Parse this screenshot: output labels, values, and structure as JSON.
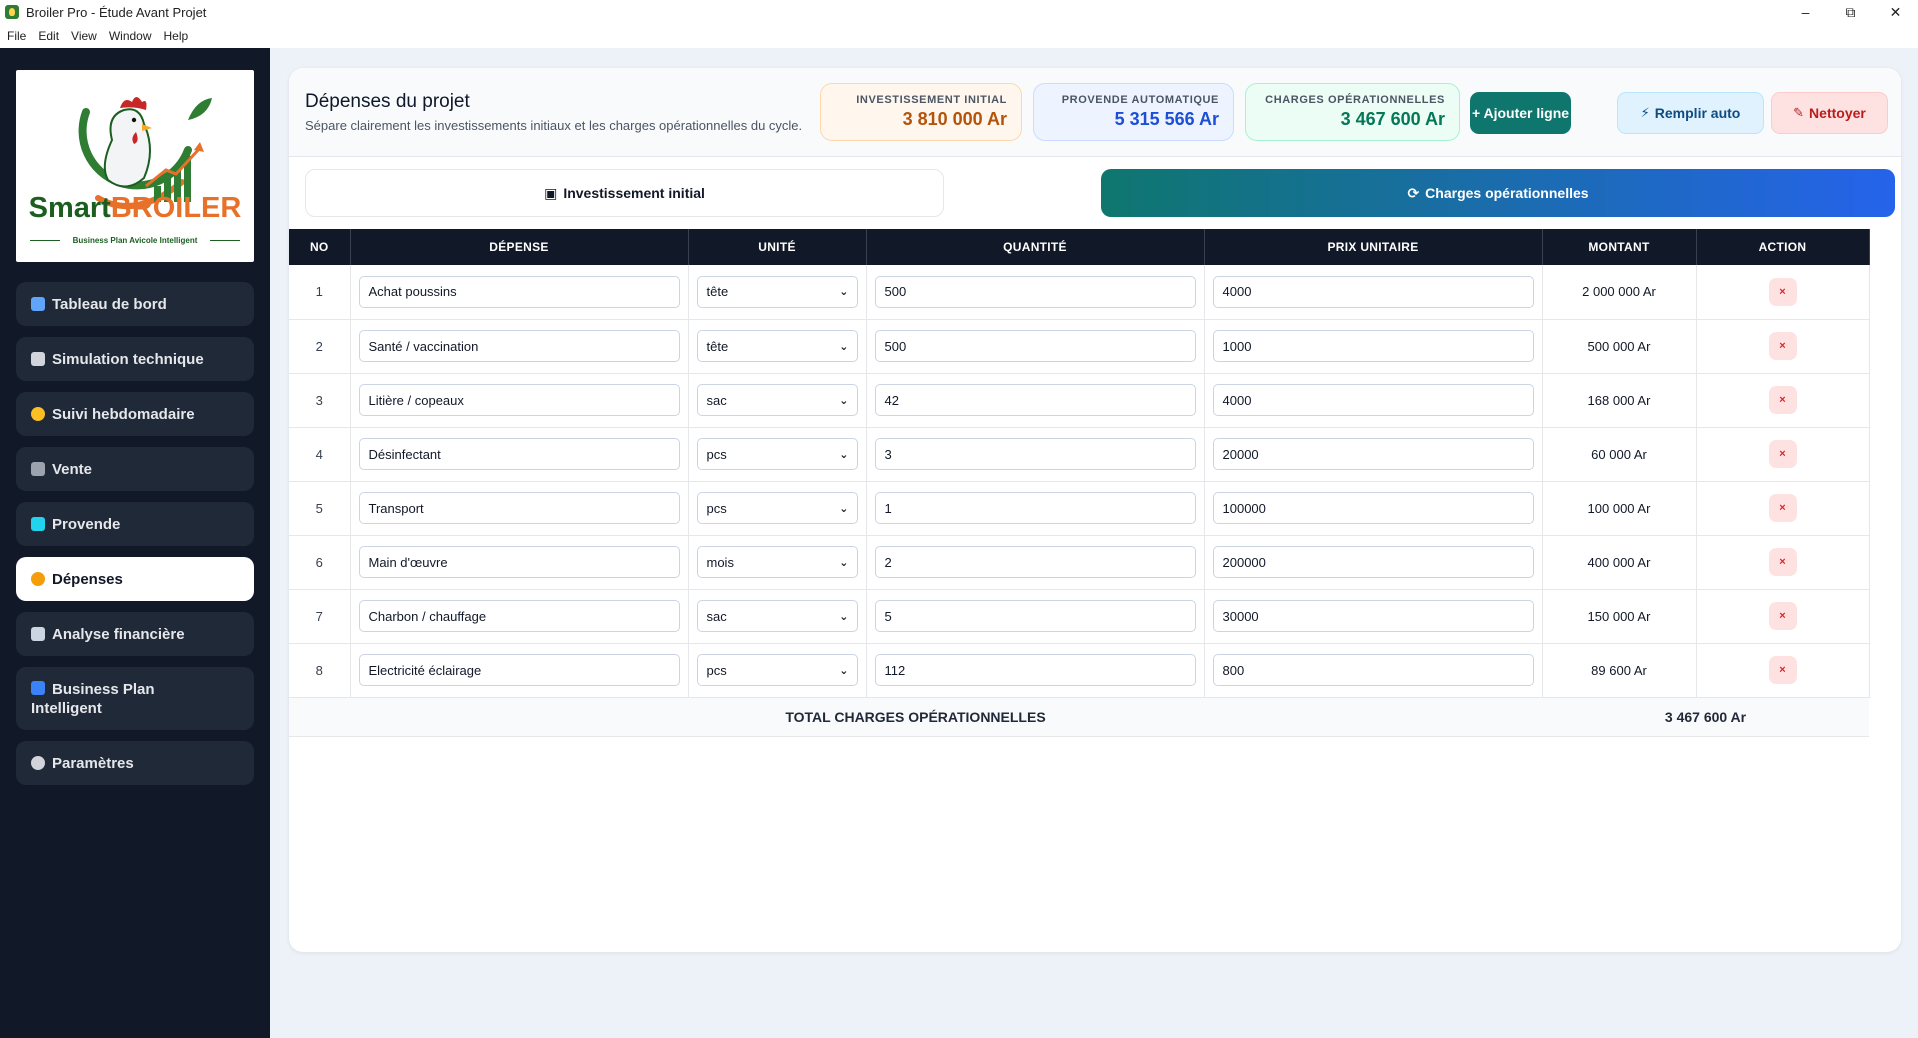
{
  "window": {
    "title": "Broiler Pro - Étude Avant Projet"
  },
  "menu": [
    "File",
    "Edit",
    "View",
    "Window",
    "Help"
  ],
  "logo": {
    "brand_left": "Smart",
    "brand_right": "BROILER",
    "tagline": "Business Plan Avicole Intelligent"
  },
  "sidebar": {
    "items": [
      {
        "label": "Tableau de bord",
        "icon": "bar-chart-icon",
        "color": "#60a5fa"
      },
      {
        "label": "Simulation technique",
        "icon": "clipboard-icon",
        "color": "#d1d5db"
      },
      {
        "label": "Suivi hebdomadaire",
        "icon": "chick-icon",
        "color": "#fbbf24"
      },
      {
        "label": "Vente",
        "icon": "cart-icon",
        "color": "#9ca3af"
      },
      {
        "label": "Provende",
        "icon": "syringe-icon",
        "color": "#22d3ee"
      },
      {
        "label": "Dépenses",
        "icon": "money-bag-icon",
        "color": "#f59e0b"
      },
      {
        "label": "Analyse financière",
        "icon": "bank-icon",
        "color": "#cbd5e1"
      },
      {
        "label_line1": "Business Plan",
        "label_line2": "Intelligent",
        "icon": "book-icon",
        "color": "#3b82f6"
      },
      {
        "label": "Paramètres",
        "icon": "gear-icon",
        "color": "#d1d5db"
      }
    ]
  },
  "header": {
    "title": "Dépenses du projet",
    "subtitle": "Sépare clairement les investissements initiaux et les charges opérationnelles du cycle."
  },
  "stats": {
    "investissement": {
      "label": "INVESTISSEMENT INITIAL",
      "value": "3 810 000 Ar"
    },
    "provende": {
      "label": "PROVENDE AUTOMATIQUE",
      "value": "5 315 566 Ar"
    },
    "charges": {
      "label": "CHARGES OPÉRATIONNELLES",
      "value": "3 467 600 Ar"
    }
  },
  "actions": {
    "add": "+ Ajouter ligne",
    "auto": "Remplir auto",
    "clean": "Nettoyer"
  },
  "tabs": {
    "investissement": "Investissement initial",
    "charges": "Charges opérationnelles"
  },
  "table": {
    "headers": [
      "NO",
      "DÉPENSE",
      "UNITÉ",
      "QUANTITÉ",
      "PRIX UNITAIRE",
      "MONTANT",
      "ACTION"
    ],
    "rows": [
      {
        "no": "1",
        "depense": "Achat poussins",
        "unite": "tête",
        "quantite": "500",
        "prix": "4000",
        "montant": "2 000 000 Ar"
      },
      {
        "no": "2",
        "depense": "Santé / vaccination",
        "unite": "tête",
        "quantite": "500",
        "prix": "1000",
        "montant": "500 000 Ar"
      },
      {
        "no": "3",
        "depense": "Litière / copeaux",
        "unite": "sac",
        "quantite": "42",
        "prix": "4000",
        "montant": "168 000 Ar"
      },
      {
        "no": "4",
        "depense": "Désinfectant",
        "unite": "pcs",
        "quantite": "3",
        "prix": "20000",
        "montant": "60 000 Ar"
      },
      {
        "no": "5",
        "depense": "Transport",
        "unite": "pcs",
        "quantite": "1",
        "prix": "100000",
        "montant": "100 000 Ar"
      },
      {
        "no": "6",
        "depense": "Main d'œuvre",
        "unite": "mois",
        "quantite": "2",
        "prix": "200000",
        "montant": "400 000 Ar"
      },
      {
        "no": "7",
        "depense": "Charbon / chauffage",
        "unite": "sac",
        "quantite": "5",
        "prix": "30000",
        "montant": "150 000 Ar"
      },
      {
        "no": "8",
        "depense": "Electricité éclairage",
        "unite": "pcs",
        "quantite": "112",
        "prix": "800",
        "montant": "89 600 Ar"
      }
    ],
    "delete_glyph": "×",
    "footer_label": "TOTAL CHARGES OPÉRATIONNELLES",
    "footer_total": "3 467 600 Ar"
  }
}
